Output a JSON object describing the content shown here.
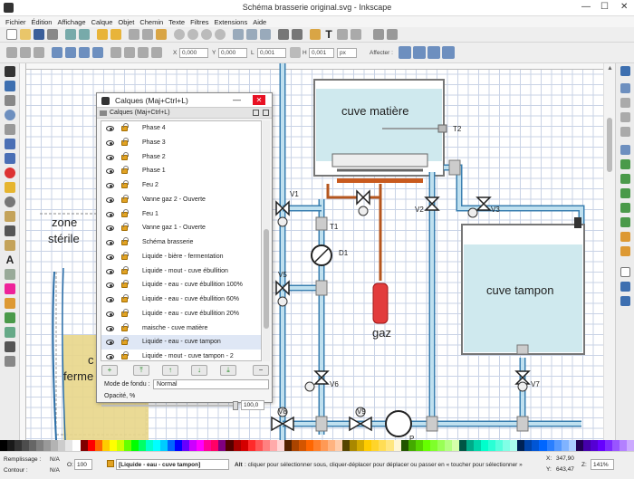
{
  "window": {
    "title": "Schéma brasserie original.svg - Inkscape",
    "minimize": "—",
    "maximize": "☐",
    "close": "✕"
  },
  "menu": [
    "Fichier",
    "Édition",
    "Affichage",
    "Calque",
    "Objet",
    "Chemin",
    "Texte",
    "Filtres",
    "Extensions",
    "Aide"
  ],
  "coords": {
    "x_label": "X",
    "x": "0,000",
    "y_label": "Y",
    "y": "0,000",
    "w_label": "L",
    "w": "0,001",
    "h_label": "H",
    "h": "0,001",
    "unit": "px",
    "affect_label": "Affecter :"
  },
  "layers": {
    "title": "Calques (Maj+Ctrl+L)",
    "tab": "Calques (Maj+Ctrl+L)",
    "items": [
      {
        "name": "Phase 4",
        "selected": false
      },
      {
        "name": "Phase 3",
        "selected": false
      },
      {
        "name": "Phase 2",
        "selected": false
      },
      {
        "name": "Phase 1",
        "selected": false
      },
      {
        "name": "Feu 2",
        "selected": false
      },
      {
        "name": "Vanne gaz 2 - Ouverte",
        "selected": false
      },
      {
        "name": "Feu 1",
        "selected": false
      },
      {
        "name": "Vanne gaz 1 - Ouverte",
        "selected": false
      },
      {
        "name": "Schéma brasserie",
        "selected": false
      },
      {
        "name": "Liquide - bière - fermentation",
        "selected": false
      },
      {
        "name": "Liquide - mout - cuve ébullition",
        "selected": false
      },
      {
        "name": "Liquide - eau - cuve ébullition 100%",
        "selected": false
      },
      {
        "name": "Liquide - eau - cuve ébullition 60%",
        "selected": false
      },
      {
        "name": "Liquide - eau - cuve ébullition 20%",
        "selected": false
      },
      {
        "name": "maische - cuve matière",
        "selected": false
      },
      {
        "name": "Liquide - eau - cuve tampon",
        "selected": true
      },
      {
        "name": "Liquide - mout - cuve tampon - 2",
        "selected": false
      }
    ],
    "blend_label": "Mode de fondu :",
    "blend_value": "Normal",
    "opacity_label": "Opacité, %",
    "opacity_value": "100,0"
  },
  "drawing": {
    "cuve_matiere": "cuve matière",
    "cuve_tampon": "cuve tampon",
    "zone_sterile_1": "zone",
    "zone_sterile_2": "stérile",
    "ferm_1": "c",
    "ferm_2": "ferme",
    "gaz": "gaz",
    "valves": [
      "V1",
      "V2",
      "V3",
      "V5",
      "V6",
      "V7",
      "V8",
      "V9"
    ],
    "T1": "T1",
    "T2": "T2",
    "D1": "D1",
    "P": "P"
  },
  "status": {
    "fill_label": "Remplissage :",
    "fill_value": "N/A",
    "stroke_label": "Contour :",
    "stroke_value": "N/A",
    "o_label": "O:",
    "o_value": "100",
    "layer_value": "[Liquide - eau - cuve tampon]",
    "message_bold": "Alt",
    "message": ": cliquer pour sélectionner sous, cliquer-déplacer pour déplacer ou passer en « toucher pour sélectionner »",
    "x_label": "X:",
    "x": "347,90",
    "y_label": "Y:",
    "y": "643,47",
    "zoom_label": "Z:",
    "zoom": "141%"
  },
  "palette": [
    "#000000",
    "#1a1a1a",
    "#333333",
    "#4d4d4d",
    "#666666",
    "#808080",
    "#999999",
    "#b3b3b3",
    "#cccccc",
    "#e6e6e6",
    "#ffffff",
    "#800000",
    "#ff0000",
    "#ff6600",
    "#ffcc00",
    "#ffff00",
    "#ccff00",
    "#66ff00",
    "#00ff00",
    "#00ff66",
    "#00ffcc",
    "#00ffff",
    "#00ccff",
    "#0066ff",
    "#0000ff",
    "#6600ff",
    "#cc00ff",
    "#ff00ff",
    "#ff0099",
    "#ff0066",
    "#800080",
    "#550000",
    "#aa0000",
    "#d40000",
    "#ff2a2a",
    "#ff5555",
    "#ff8080",
    "#ffaaaa",
    "#ffd5d5",
    "#552200",
    "#aa4400",
    "#d45500",
    "#ff6600",
    "#ff7f2a",
    "#ff9955",
    "#ffb380",
    "#ffccaa",
    "#554400",
    "#aa8800",
    "#d4aa00",
    "#ffcc00",
    "#ffd42a",
    "#ffdd55",
    "#ffe680",
    "#fff6d5",
    "#225500",
    "#44aa00",
    "#55d400",
    "#66ff00",
    "#7fff2a",
    "#99ff55",
    "#b3ff80",
    "#d5ffaa",
    "#005544",
    "#00aa88",
    "#00d4aa",
    "#00ffcc",
    "#2affd5",
    "#55ffdd",
    "#80ffe6",
    "#aaffee",
    "#002255",
    "#0044aa",
    "#0055d4",
    "#0066ff",
    "#2a7fff",
    "#5599ff",
    "#80b3ff",
    "#aaccff",
    "#220055",
    "#4400aa",
    "#5500d4",
    "#6600ff",
    "#7f2aff",
    "#9955ff",
    "#b380ff",
    "#ccaaff"
  ]
}
